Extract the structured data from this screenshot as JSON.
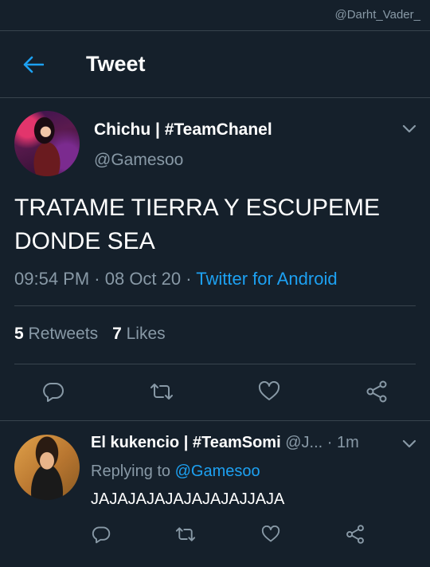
{
  "watermark": "@Darht_Vader_",
  "header": {
    "title": "Tweet",
    "back_icon": "arrow-left-icon"
  },
  "tweet": {
    "author_name": "Chichu | #TeamChanel",
    "author_handle": "@Gamesoo",
    "text_line1": "TRATAME TIERRA Y ESCUPEME",
    "text_line2": "DONDE SEA",
    "time": "09:54 PM",
    "date": "08 Oct 20",
    "source": "Twitter for Android",
    "retweets_count": "5",
    "retweets_label": "Retweets",
    "likes_count": "7",
    "likes_label": "Likes"
  },
  "reply": {
    "author_name": "El kukencio | #TeamSomi",
    "author_handle": "@J...",
    "time_ago": "1m",
    "replying_prefix": "Replying to",
    "replying_to": "@Gamesoo",
    "text": "JAJAJAJAJAJAJAJAJJAJA"
  },
  "colors": {
    "background": "#15202b",
    "divider": "#38444d",
    "muted_text": "#8899a6",
    "accent": "#1da1f2"
  }
}
